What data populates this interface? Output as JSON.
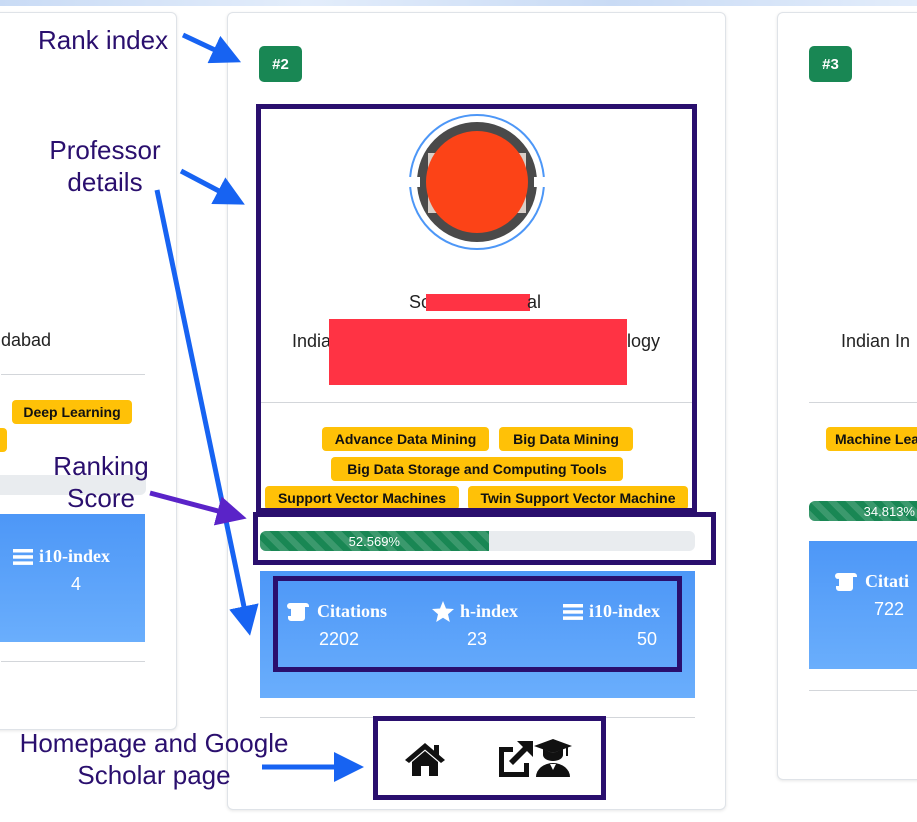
{
  "annotations": {
    "rank_index": "Rank index",
    "professor_details_line1": "Professor",
    "professor_details_line2": "details",
    "ranking_score_line1": "Ranking",
    "ranking_score_line2": "Score",
    "homepage_line1": "Homepage and Google",
    "homepage_line2": "Scholar page"
  },
  "cards": {
    "left": {
      "institute_fragment": "dabad",
      "tags": [
        "Deep Learning"
      ],
      "stat": {
        "label": "i10-index",
        "value": "4"
      }
    },
    "main": {
      "rank": "#2",
      "name_start": "Sc",
      "name_end": "al",
      "institute_start": "India",
      "institute_end": "logy",
      "tags": [
        "Advance Data Mining",
        "Big Data Mining",
        "Big Data Storage and Computing Tools",
        "Support Vector Machines",
        "Twin Support Vector Machine"
      ],
      "score": 52.569,
      "score_label": "52.569%",
      "stats": [
        {
          "label": "Citations",
          "value": "2202",
          "icon": "scroll-icon"
        },
        {
          "label": "h-index",
          "value": "23",
          "icon": "star-icon"
        },
        {
          "label": "i10-index",
          "value": "50",
          "icon": "list-icon"
        }
      ],
      "links": {
        "homepage_icon": "home-icon",
        "scholar_icons": [
          "external-link-icon",
          "graduate-icon"
        ]
      }
    },
    "right": {
      "rank": "#3",
      "institute_fragment": "Indian In",
      "tags": [
        "Machine Lea"
      ],
      "score": 34.813,
      "score_label": "34.813%",
      "stat": {
        "label": "Citati",
        "value": "722"
      }
    }
  },
  "colors": {
    "rank_badge": "#198754",
    "tag": "#ffc107",
    "progress": "#198754",
    "stats_panel": "#4d97f7",
    "annotation": "#2a0f6e",
    "arrow_blue": "#1763f2",
    "arrow_purple": "#5a23c8",
    "redaction": "#ff3344",
    "avatar_redaction": "#fc4317"
  }
}
